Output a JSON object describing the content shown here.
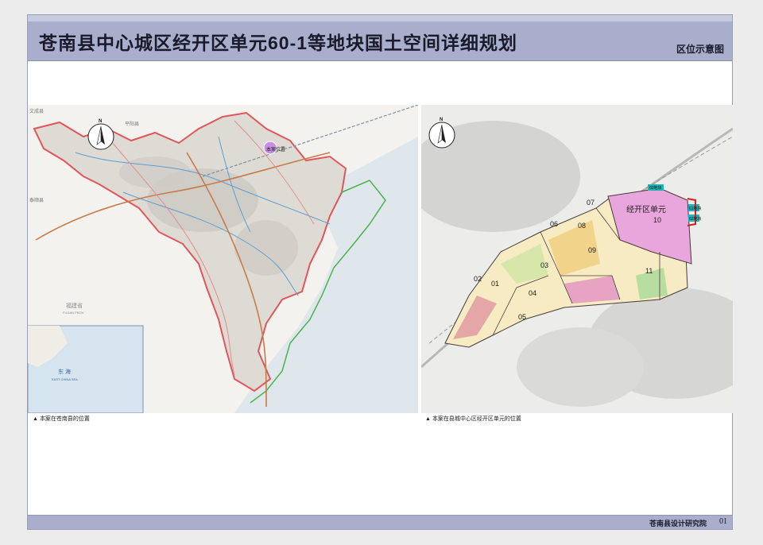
{
  "header": {
    "title": "苍南县中心城区经开区单元60-1等地块国土空间详细规划",
    "subtitle": "区位示意图"
  },
  "footer": {
    "institute": "苍南县设计研究院",
    "page_number": "01"
  },
  "left_map": {
    "caption": "本案在苍南县的位置",
    "project_marker_label": "本案位置",
    "north_label": "N",
    "place_labels": {
      "wencheng": "文成县",
      "pingyang": "平阳县",
      "taishun": "泰顺县",
      "fujian": "福建省",
      "fujian_en": "FUJIAN PROV.",
      "donghai": "东 海",
      "donghai_en": "EAST CHINA SEA"
    }
  },
  "right_map": {
    "caption": "本案在县城中心区经开区单元的位置",
    "north_label": "N",
    "unit_label": "经开区单元",
    "parcels": [
      "01",
      "02",
      "03",
      "04",
      "05",
      "06",
      "07",
      "08",
      "09",
      "10",
      "11"
    ],
    "plot_labels": [
      "60地块",
      "61地块",
      "62地块"
    ]
  },
  "colors": {
    "title_bar": "#a8aecb",
    "county_boundary": "#e0565a",
    "unit_fill": "#e9a6dd",
    "plot_marker": "#1fb5b8",
    "project_marker": "#c88ee3"
  }
}
